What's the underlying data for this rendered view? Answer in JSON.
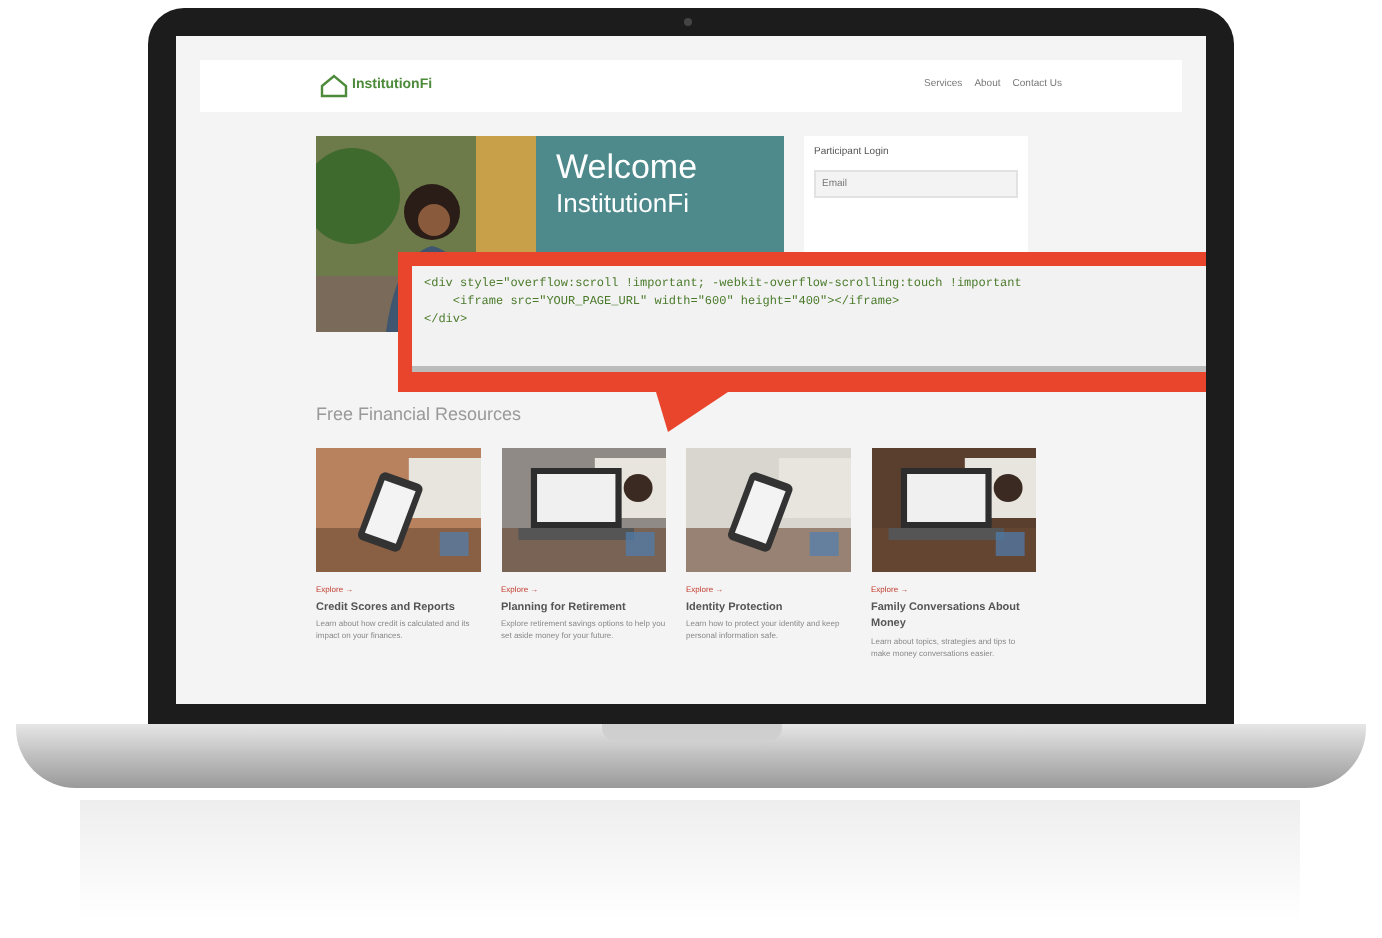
{
  "header": {
    "logo": "InstitutionFi",
    "nav": [
      {
        "label": "Services"
      },
      {
        "label": "About"
      },
      {
        "label": "Contact Us"
      }
    ]
  },
  "hero": {
    "title": "Welcome",
    "subtitle": "InstitutionFi"
  },
  "login": {
    "title": "Participant Login",
    "fields": [
      {
        "placeholder": "Email"
      }
    ]
  },
  "code_callout": {
    "lines": [
      "<div style=\"overflow:scroll !important; -webkit-overflow-scrolling:touch !important",
      "    <iframe src=\"YOUR_PAGE_URL\" width=\"600\" height=\"400\"></iframe>",
      "</div>"
    ]
  },
  "section_title": "Free Financial Resources",
  "cards": [
    {
      "link": "Explore →",
      "title": "Credit Scores and Reports",
      "text": "Learn about how credit is calculated and its impact on your finances."
    },
    {
      "link": "Explore →",
      "title": "Planning for Retirement",
      "text": "Explore retirement savings options to help you set aside money for your future."
    },
    {
      "link": "Explore →",
      "title": "Identity Protection",
      "text": "Learn how to protect your identity and keep personal information safe."
    },
    {
      "link": "Explore →",
      "title": "Family Conversations About Money",
      "text": "Learn about topics, strategies and tips to make money conversations easier."
    }
  ]
}
